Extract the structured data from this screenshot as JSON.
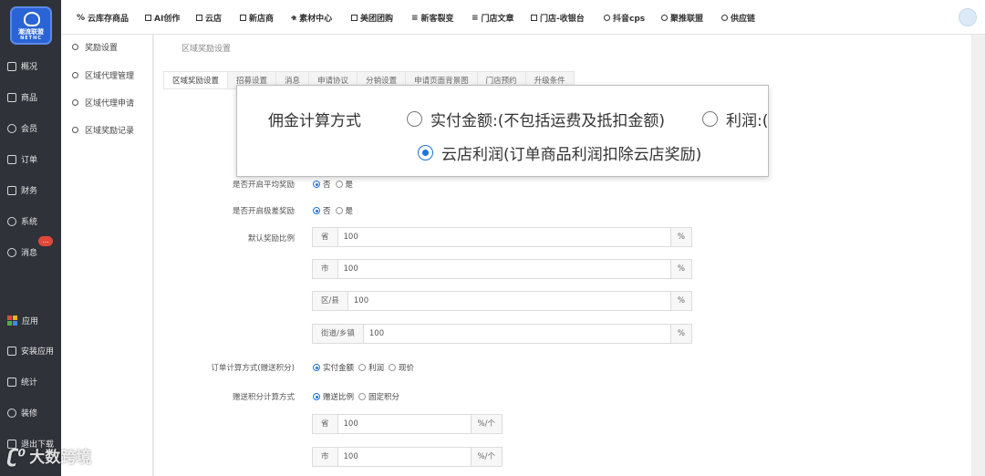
{
  "logo": {
    "line1": "潮流联盟",
    "line2": "NETHC"
  },
  "leftnav": [
    {
      "label": "概况",
      "icon": "dashboard-icon"
    },
    {
      "label": "商品",
      "icon": "product-icon"
    },
    {
      "label": "会员",
      "icon": "member-icon"
    },
    {
      "label": "订单",
      "icon": "cart-icon"
    },
    {
      "label": "财务",
      "icon": "finance-icon"
    },
    {
      "label": "系统",
      "icon": "gear-icon"
    },
    {
      "label": "消息",
      "icon": "message-icon"
    },
    {
      "label": "应用",
      "icon": "apps-icon"
    },
    {
      "label": "安装应用",
      "icon": "install-icon"
    },
    {
      "label": "统计",
      "icon": "stats-icon"
    },
    {
      "label": "装修",
      "icon": "decorate-icon"
    },
    {
      "label": "退出下载",
      "icon": "logout-icon"
    }
  ],
  "message_badge": "...",
  "topnav": [
    "云库存商品",
    "AI创作",
    "云店",
    "新店商",
    "素材中心",
    "美团团购",
    "新客裂变",
    "门店文章",
    "门店-收银台",
    "抖音cps",
    "聚推联盟",
    "供应链"
  ],
  "subnav": [
    "奖励设置",
    "区域代理管理",
    "区域代理申请",
    "区域奖励记录"
  ],
  "breadcrumb": "区域奖励设置",
  "tabs": [
    "区域奖励设置",
    "招募设置",
    "消息",
    "申请协议",
    "分销设置",
    "申请页面背景图",
    "门店预约",
    "升级条件"
  ],
  "popup": {
    "label": "佣金计算方式",
    "options": [
      "实付金额:(不包括运费及抵扣金额)",
      "利润:(",
      "云店利润(订单商品利润扣除云店奖励)"
    ],
    "selected": 2
  },
  "form": {
    "avg_reward": {
      "label": "是否开启平均奖励",
      "options": [
        "否",
        "是"
      ],
      "selected": 0
    },
    "diff_reward": {
      "label": "是否开启极差奖励",
      "options": [
        "否",
        "是"
      ],
      "selected": 0
    },
    "default_ratio": {
      "label": "默认奖励比例",
      "rows": [
        {
          "prefix": "省",
          "value": "100",
          "suffix": "%"
        },
        {
          "prefix": "市",
          "value": "100",
          "suffix": "%"
        },
        {
          "prefix": "区/县",
          "value": "100",
          "suffix": "%"
        },
        {
          "prefix": "街道/乡镇",
          "value": "100",
          "suffix": "%"
        }
      ]
    },
    "order_calc": {
      "label": "订单计算方式(赠送积分)",
      "options": [
        "实付金额",
        "利润",
        "现价"
      ],
      "selected": 0
    },
    "points_calc": {
      "label": "赠送积分计算方式",
      "options": [
        "赠送比例",
        "固定积分"
      ],
      "selected": 0
    },
    "points_rows": [
      {
        "prefix": "省",
        "value": "100",
        "suffix": "%/个"
      },
      {
        "prefix": "市",
        "value": "100",
        "suffix": "%/个"
      }
    ]
  },
  "watermark": "大数跨境",
  "colors": {
    "sidebar": "#2f3238",
    "accent": "#1e73d8",
    "badge": "#e3473b"
  }
}
